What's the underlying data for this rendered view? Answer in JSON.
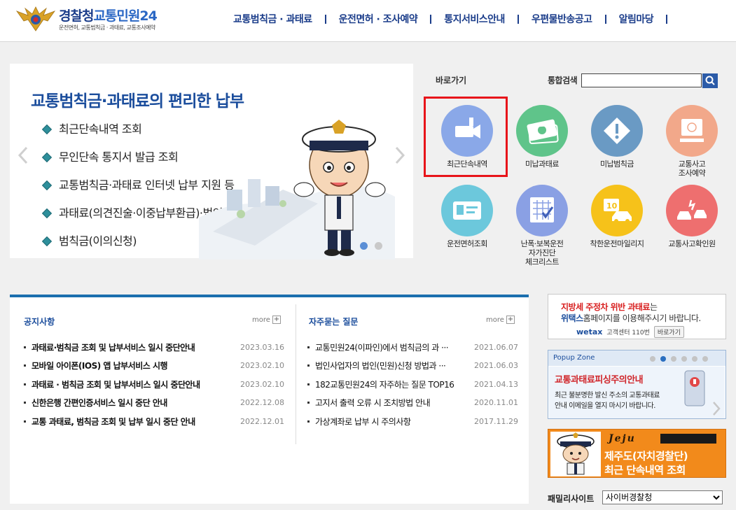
{
  "header": {
    "logo_prefix": "경찰청",
    "logo_suffix": "교통민원24",
    "logo_sub": "운전면허, 교통범칙금 · 과태료, 교통조사예약",
    "nav": [
      "교통범칙금 · 과태료",
      "운전면허 · 조사예약",
      "통지서비스안내",
      "우편물반송공고",
      "알림마당"
    ]
  },
  "banner": {
    "title": "교통범칙금·과태료의 편리한 납부",
    "items": [
      "최근단속내역 조회",
      "무인단속 통지서 발급 조회",
      "교통범칙금·과태료 인터넷 납부 지원 등",
      "과태료(의견진술·이중납부환급)·법인신청",
      "범칙금(이의신청)"
    ],
    "slides": 2,
    "active_slide": 0
  },
  "quick": {
    "label": "바로가기",
    "search_label": "통합검색",
    "search_value": "",
    "items": [
      {
        "label": "최근단속내역",
        "icon": "camera-icon",
        "color": "#8aa8e8"
      },
      {
        "label": "미납과태료",
        "icon": "money-icon",
        "color": "#5fc48a"
      },
      {
        "label": "미납범칙금",
        "icon": "warning-icon",
        "color": "#6a9ac4"
      },
      {
        "label": "교통사고\n조사예약",
        "icon": "computer-icon",
        "color": "#f2a88a"
      },
      {
        "label": "운전면허조회",
        "icon": "license-card-icon",
        "color": "#6cc8dc"
      },
      {
        "label": "난폭·보복운전\n자가진단\n체크리스트",
        "icon": "checklist-icon",
        "color": "#8aa0e4"
      },
      {
        "label": "착한운전마일리지",
        "icon": "mileage-car-icon",
        "color": "#f6c21a"
      },
      {
        "label": "교통사고확인원",
        "icon": "car-crash-icon",
        "color": "#ee6f6f"
      }
    ]
  },
  "notice": {
    "title": "공지사항",
    "more": "more",
    "items": [
      {
        "title": "과태료·범칙금 조회 및 납부서비스 일시 중단안내",
        "date": "2023.03.16"
      },
      {
        "title": "모바일 아이폰(IOS) 앱 납부서비스 시행",
        "date": "2023.02.10"
      },
      {
        "title": "과태료 · 범칙금 조회 및 납부서비스 일시 중단안내",
        "date": "2023.02.10"
      },
      {
        "title": "신한은행 간편인증서비스 일시 중단 안내",
        "date": "2022.12.08"
      },
      {
        "title": "교통 과태료, 범칙금 조회 및 납부 일시 중단 안내",
        "date": "2022.12.01"
      }
    ]
  },
  "faq": {
    "title": "자주묻는 질문",
    "more": "more",
    "items": [
      {
        "title": "교통민원24(이파인)에서 범칙금의 과 ···",
        "date": "2021.06.07"
      },
      {
        "title": "법인사업자의 법인(민원)신청 방법과 ···",
        "date": "2021.06.03"
      },
      {
        "title": "182교통민원24의 자주하는 질문 TOP16",
        "date": "2021.04.13"
      },
      {
        "title": "고지서 출력 오류 시 조치방법 안내",
        "date": "2020.11.01"
      },
      {
        "title": "가상계좌로 납부 시 주의사항",
        "date": "2017.11.29"
      }
    ]
  },
  "wetax": {
    "line1_red": "지방세 주정차 위반 과태료",
    "line1_rest": "는",
    "line2_blue": "위택스",
    "line2_rest": "홈페이지를 이용해주시기 바랍니다.",
    "logo": "wetax",
    "center": "고객센터 110번",
    "button": "바로가기"
  },
  "popup": {
    "title": "Popup Zone",
    "slides": 6,
    "active_slide": 1,
    "main": "교통과태료피싱주의안내",
    "sub1": "최근 불분명한 발신 주소의 교통과태료",
    "sub2": "안내 이메일을 열지 마시기 바랍니다."
  },
  "jeju": {
    "brand": "Jeju",
    "line1": "제주도(자치경찰단)",
    "line2": "최근 단속내역 조회"
  },
  "family": {
    "label": "패밀리사이트",
    "selected": "사이버경찰청"
  }
}
